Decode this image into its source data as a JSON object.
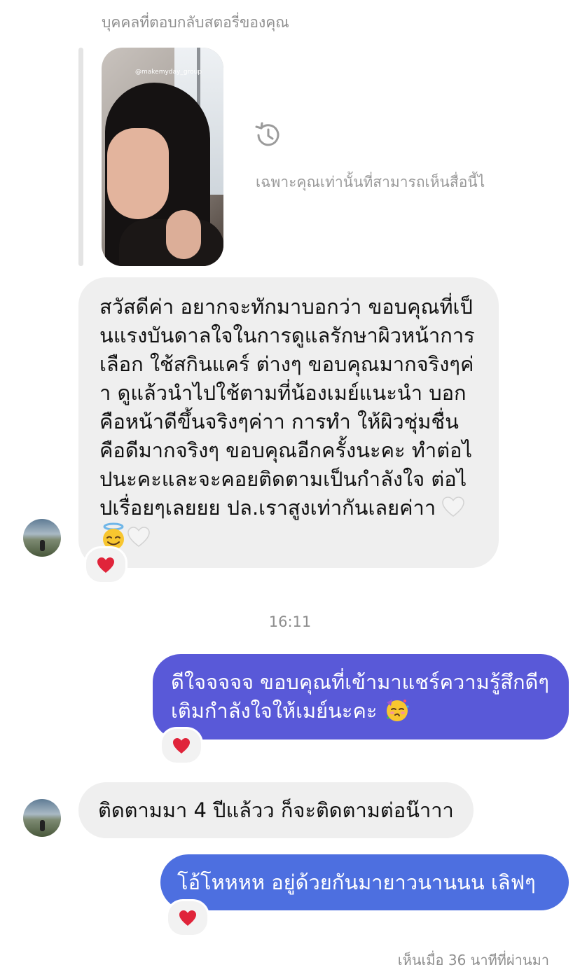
{
  "story_reply": {
    "header": "บุคคลที่ตอบกลับสตอรี่ของคุณ",
    "story_handle": "@makemyday_group",
    "private_note": "เฉพาะคุณเท่านั้นที่สามารถเห็นสื่อนี้ไ"
  },
  "messages": [
    {
      "sender": "other",
      "text": "สวัสดีค่า อยากจะทักมาบอกว่า ขอบคุณที่เป็นแรงบันดาลใจในการดูแลรักษาผิวหน้าการเลือก ใช้สกินแคร์ ต่างๆ ขอบคุณมากจริงๆค่า ดูแล้วนำไปใช้ตามที่น้องเมย์แนะนำ บอก คือหน้าดีขึ้นจริงๆค่าา การทำ ให้ผิวชุ่มชื่น คือดีมากจริงๆ ขอบคุณอีกครั้งนะคะ ทำต่อไปนะคะและจะคอยติดตามเป็นกำลังใจ ต่อไปเรื่อยๆเลยยย ปล.เราสูงเท่ากันเลยค่าา",
      "emojis": [
        "white-heart",
        "smiling-face-with-halo",
        "white-heart"
      ],
      "reaction": "red-heart"
    },
    {
      "sender": "me",
      "text": "ดีใจจจจจ ขอบคุณที่เข้ามาแชร์ความรู้สึกดีๆ เติมกำลังใจให้เมย์นะคะ",
      "emojis": [
        "face-blowing-a-kiss-party"
      ],
      "reaction": "red-heart"
    },
    {
      "sender": "other",
      "text": "ติดตามมา 4 ปีแล้วว ก็จะติดตามต่อน๊าาา"
    },
    {
      "sender": "me",
      "text": "โอ้โหหหห อยู่ด้วยกันมายาวนานนน เลิฟๆ",
      "reaction": "red-heart"
    }
  ],
  "timestamp": "16:11",
  "seen_status": "เห็นเมื่อ 36 นาทีที่ผ่านมา",
  "colors": {
    "incoming_bubble": "#efefef",
    "outgoing_bubble_1": "#5959d8",
    "outgoing_bubble_2": "#4d6fe0",
    "meta_text": "#8e8e8e",
    "heart": "#e0243a"
  }
}
